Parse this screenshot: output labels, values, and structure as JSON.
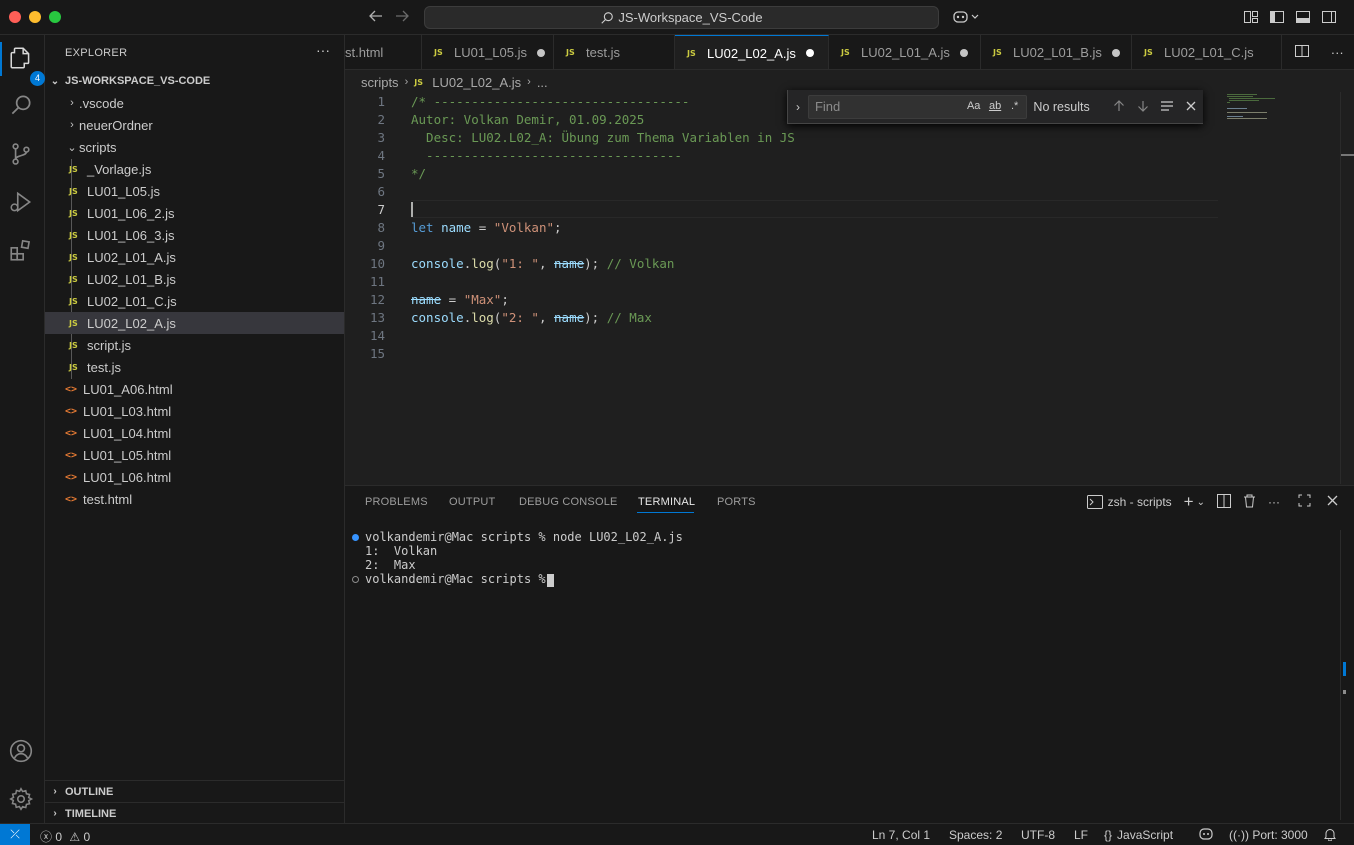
{
  "window": {
    "title": "JS-Workspace_VS-Code"
  },
  "activity": {
    "explorer_badge": "4"
  },
  "sidebar": {
    "title": "EXPLORER",
    "workspace": "JS-WORKSPACE_VS-CODE",
    "tree": [
      {
        "label": ".vscode",
        "type": "folder",
        "expanded": false,
        "depth": 0
      },
      {
        "label": "neuerOrdner",
        "type": "folder",
        "expanded": false,
        "depth": 0
      },
      {
        "label": "scripts",
        "type": "folder",
        "expanded": true,
        "depth": 0
      },
      {
        "label": "_Vorlage.js",
        "type": "js",
        "depth": 1
      },
      {
        "label": "LU01_L05.js",
        "type": "js",
        "depth": 1
      },
      {
        "label": "LU01_L06_2.js",
        "type": "js",
        "depth": 1
      },
      {
        "label": "LU01_L06_3.js",
        "type": "js",
        "depth": 1
      },
      {
        "label": "LU02_L01_A.js",
        "type": "js",
        "depth": 1
      },
      {
        "label": "LU02_L01_B.js",
        "type": "js",
        "depth": 1
      },
      {
        "label": "LU02_L01_C.js",
        "type": "js",
        "depth": 1
      },
      {
        "label": "LU02_L02_A.js",
        "type": "js",
        "depth": 1,
        "selected": true
      },
      {
        "label": "script.js",
        "type": "js",
        "depth": 1
      },
      {
        "label": "test.js",
        "type": "js",
        "depth": 1
      },
      {
        "label": "LU01_A06.html",
        "type": "html",
        "depth": 0
      },
      {
        "label": "LU01_L03.html",
        "type": "html",
        "depth": 0
      },
      {
        "label": "LU01_L04.html",
        "type": "html",
        "depth": 0
      },
      {
        "label": "LU01_L05.html",
        "type": "html",
        "depth": 0
      },
      {
        "label": "LU01_L06.html",
        "type": "html",
        "depth": 0
      },
      {
        "label": "test.html",
        "type": "html",
        "depth": 0
      }
    ],
    "outline": "OUTLINE",
    "timeline": "TIMELINE"
  },
  "tabs": [
    {
      "label": "st.html",
      "icon": "html",
      "dirty": false,
      "active": false
    },
    {
      "label": "LU01_L05.js",
      "icon": "js",
      "dirty": true,
      "active": false
    },
    {
      "label": "test.js",
      "icon": "js",
      "dirty": false,
      "active": false
    },
    {
      "label": "LU02_L02_A.js",
      "icon": "js",
      "dirty": true,
      "active": true
    },
    {
      "label": "LU02_L01_A.js",
      "icon": "js",
      "dirty": true,
      "active": false
    },
    {
      "label": "LU02_L01_B.js",
      "icon": "js",
      "dirty": true,
      "active": false
    },
    {
      "label": "LU02_L01_C.js",
      "icon": "js",
      "dirty": false,
      "active": false
    }
  ],
  "breadcrumb": {
    "folder": "scripts",
    "file": "LU02_L02_A.js",
    "tail": "..."
  },
  "editor": {
    "current_line": 7,
    "lines": [
      [
        {
          "t": "/* ----------------------------------",
          "c": "cmt"
        }
      ],
      [
        {
          "t": "Autor: Volkan Demir, 01.09.2025",
          "c": "cmt"
        }
      ],
      [
        {
          "t": "  Desc: LU02.L02_A: Übung zum Thema Variablen in JS",
          "c": "cmt"
        }
      ],
      [
        {
          "t": "  ----------------------------------",
          "c": "cmt"
        }
      ],
      [
        {
          "t": "*/",
          "c": "cmt"
        }
      ],
      [],
      [],
      [
        {
          "t": "let",
          "c": "kw"
        },
        {
          "t": " "
        },
        {
          "t": "name",
          "c": "var"
        },
        {
          "t": " = "
        },
        {
          "t": "\"Volkan\"",
          "c": "str"
        },
        {
          "t": ";"
        }
      ],
      [],
      [
        {
          "t": "console",
          "c": "var"
        },
        {
          "t": "."
        },
        {
          "t": "log",
          "c": "fn"
        },
        {
          "t": "("
        },
        {
          "t": "\"1: \"",
          "c": "str"
        },
        {
          "t": ", "
        },
        {
          "t": "name",
          "c": "dep"
        },
        {
          "t": "); "
        },
        {
          "t": "// Volkan",
          "c": "cmt"
        }
      ],
      [],
      [
        {
          "t": "name",
          "c": "dep"
        },
        {
          "t": " = "
        },
        {
          "t": "\"Max\"",
          "c": "str"
        },
        {
          "t": ";"
        }
      ],
      [
        {
          "t": "console",
          "c": "var"
        },
        {
          "t": "."
        },
        {
          "t": "log",
          "c": "fn"
        },
        {
          "t": "("
        },
        {
          "t": "\"2: \"",
          "c": "str"
        },
        {
          "t": ", "
        },
        {
          "t": "name",
          "c": "dep"
        },
        {
          "t": "); "
        },
        {
          "t": "// Max",
          "c": "cmt"
        }
      ],
      [],
      []
    ]
  },
  "find": {
    "placeholder": "Find",
    "opt_case": "Aa",
    "opt_word": "ab",
    "opt_regex": ".*",
    "status": "No results"
  },
  "panel": {
    "tabs": [
      "PROBLEMS",
      "OUTPUT",
      "DEBUG CONSOLE",
      "TERMINAL",
      "PORTS"
    ],
    "active_tab": "TERMINAL",
    "terminal_name": "zsh - scripts",
    "terminal_lines": [
      "volkandemir@Mac scripts % node LU02_L02_A.js",
      "1:  Volkan",
      "2:  Max",
      "volkandemir@Mac scripts % "
    ]
  },
  "statusbar": {
    "errors": "0",
    "warnings": "0",
    "position": "Ln 7, Col 1",
    "spaces": "Spaces: 2",
    "encoding": "UTF-8",
    "eol": "LF",
    "language": "JavaScript",
    "port": "Port: 3000"
  },
  "colors": {
    "accent": "#0078d4",
    "comment": "#6a9955",
    "keyword": "#569cd6",
    "string": "#ce9178",
    "function": "#dcdcaa",
    "variable": "#9cdcfe"
  }
}
